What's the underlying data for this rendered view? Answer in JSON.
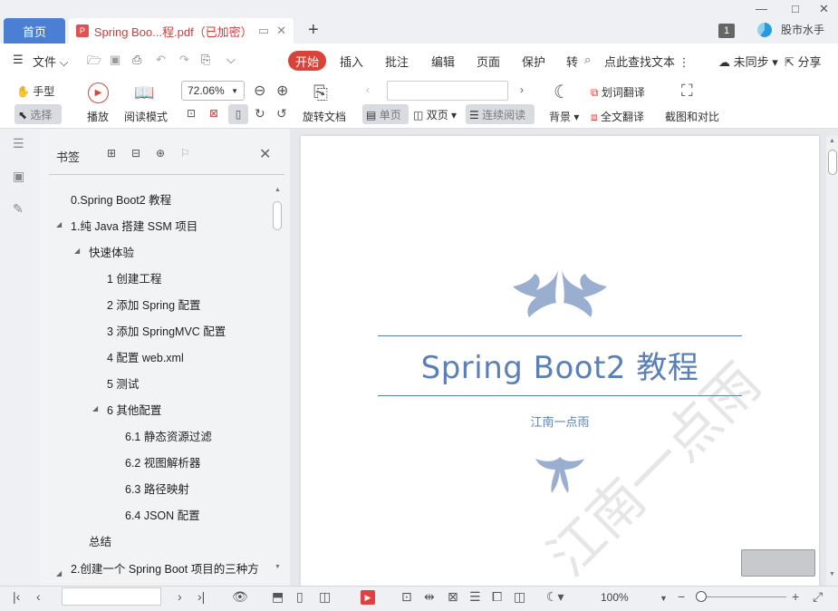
{
  "tabs": {
    "home": "首页",
    "document": "Spring Boo...程.pdf（已加密）"
  },
  "titlebar": {
    "page_count": "1",
    "user": "股市水手"
  },
  "menu": {
    "file": "文件",
    "items": [
      "开始",
      "插入",
      "批注",
      "编辑",
      "页面",
      "保护",
      "转"
    ],
    "search": "点此查找文本",
    "sync": "未同步",
    "share": "分享"
  },
  "ribbon": {
    "hand": "手型",
    "select": "选择",
    "play": "播放",
    "read_mode": "阅读模式",
    "zoom": "72.06%",
    "rotate": "旋转文档",
    "single": "单页",
    "double": "双页",
    "continuous": "连续阅读",
    "background": "背景",
    "word_translate": "划词翻译",
    "full_translate": "全文翻译",
    "screenshot": "截图和对比"
  },
  "bookmarks": {
    "title": "书签",
    "items": [
      {
        "label": "0.Spring Boot2 教程"
      },
      {
        "label": "1.纯 Java 搭建 SSM 项目"
      },
      {
        "label": "快速体验"
      },
      {
        "label": "1 创建工程"
      },
      {
        "label": "2 添加 Spring 配置"
      },
      {
        "label": "3 添加 SpringMVC 配置"
      },
      {
        "label": "4 配置 web.xml"
      },
      {
        "label": "5 测试"
      },
      {
        "label": "6 其他配置"
      },
      {
        "label": "6.1 静态资源过滤"
      },
      {
        "label": "6.2 视图解析器"
      },
      {
        "label": "6.3 路径映射"
      },
      {
        "label": "6.4 JSON 配置"
      },
      {
        "label": "总结"
      },
      {
        "label": "2.创建一个 Spring Boot 项目的三种方"
      }
    ]
  },
  "document": {
    "title": "Spring Boot2  教程",
    "author": "江南一点雨",
    "watermark": "江南一点雨"
  },
  "statusbar": {
    "zoom": "100%"
  }
}
